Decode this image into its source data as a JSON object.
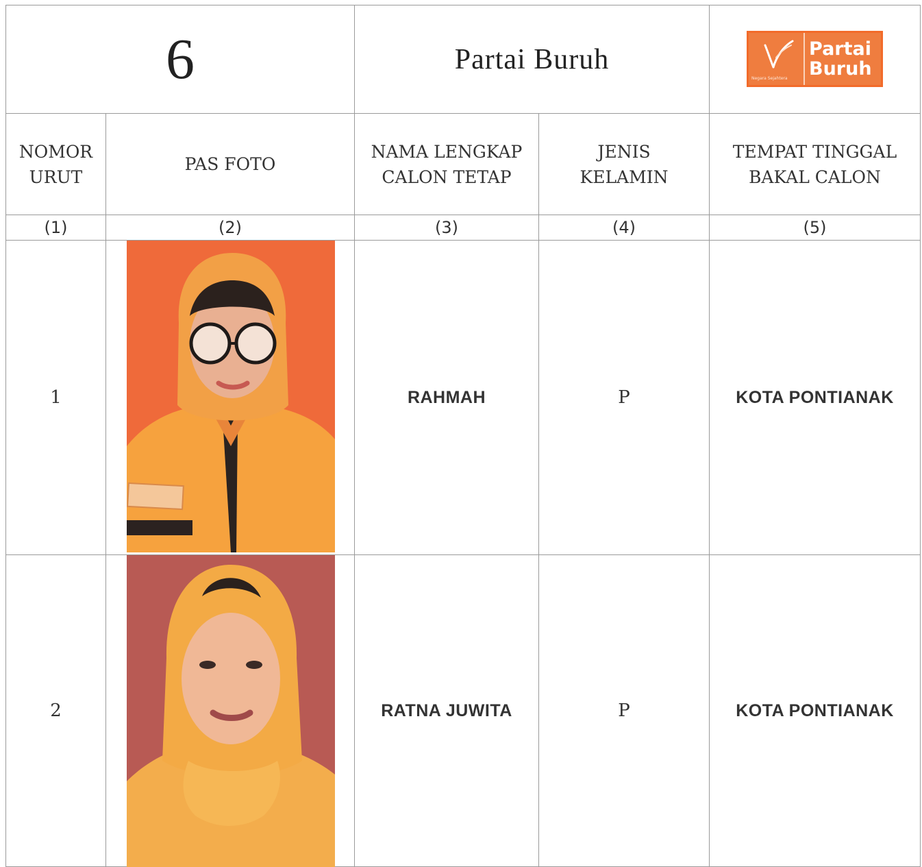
{
  "header": {
    "party_number": "6",
    "party_name": "Partai Buruh",
    "logo": {
      "word_top": "Partai",
      "word_bottom": "Buruh",
      "tagline": "Negara Sejahtera",
      "brand_color": "#ef7d3f"
    }
  },
  "columns": [
    {
      "title": "NOMOR URUT",
      "number": "(1)"
    },
    {
      "title": "PAS FOTO",
      "number": "(2)"
    },
    {
      "title": "NAMA LENGKAP CALON TETAP",
      "number": "(3)"
    },
    {
      "title": "JENIS KELAMIN",
      "number": "(4)"
    },
    {
      "title": "TEMPAT TINGGAL BAKAL CALON",
      "number": "(5)"
    }
  ],
  "rows": [
    {
      "nomor": "1",
      "photo": "candidate-photo",
      "nama": "RAHMAH",
      "jenis_kelamin": "P",
      "tempat_tinggal": "KOTA PONTIANAK"
    },
    {
      "nomor": "2",
      "photo": "candidate-photo",
      "nama": "RATNA JUWITA",
      "jenis_kelamin": "P",
      "tempat_tinggal": "KOTA PONTIANAK"
    }
  ]
}
